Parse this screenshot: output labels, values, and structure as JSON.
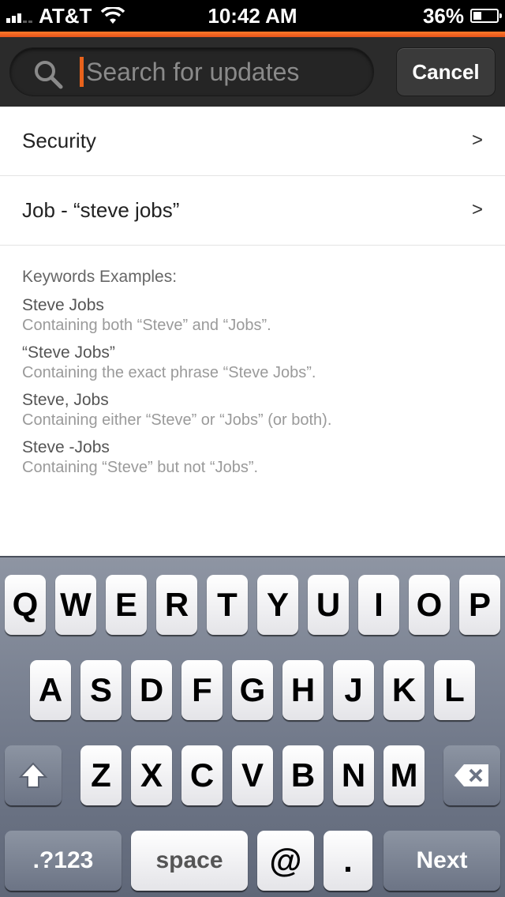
{
  "status_bar": {
    "carrier": "AT&T",
    "time": "10:42 AM",
    "battery_percent": "36%",
    "battery_level": 0.36,
    "signal_bars": 3
  },
  "search": {
    "placeholder": "Search for updates",
    "value": "",
    "cancel_label": "Cancel"
  },
  "list": [
    {
      "label": "Security",
      "chevron": ">"
    },
    {
      "label": "Job - “steve jobs”",
      "chevron": ">"
    }
  ],
  "examples": {
    "heading": "Keywords Examples:",
    "items": [
      {
        "term": "Steve Jobs",
        "desc": "Containing both “Steve” and “Jobs”."
      },
      {
        "term": "“Steve Jobs”",
        "desc": "Containing the exact phrase “Steve Jobs”."
      },
      {
        "term": "Steve, Jobs",
        "desc": "Containing either “Steve” or “Jobs” (or both)."
      },
      {
        "term": "Steve -Jobs",
        "desc": "Containing “Steve” but not “Jobs”."
      }
    ]
  },
  "keyboard": {
    "row1": [
      "Q",
      "W",
      "E",
      "R",
      "T",
      "Y",
      "U",
      "I",
      "O",
      "P"
    ],
    "row2": [
      "A",
      "S",
      "D",
      "F",
      "G",
      "H",
      "J",
      "K",
      "L"
    ],
    "row3": [
      "Z",
      "X",
      "C",
      "V",
      "B",
      "N",
      "M"
    ],
    "numbers_label": ".?123",
    "space_label": "space",
    "at_label": "@",
    "dot_label": ".",
    "next_label": "Next",
    "shift_icon": "shift-arrow-icon",
    "backspace_icon": "backspace-icon"
  },
  "colors": {
    "accent_orange": "#e8621b",
    "header_bg": "#2b2b2b"
  }
}
